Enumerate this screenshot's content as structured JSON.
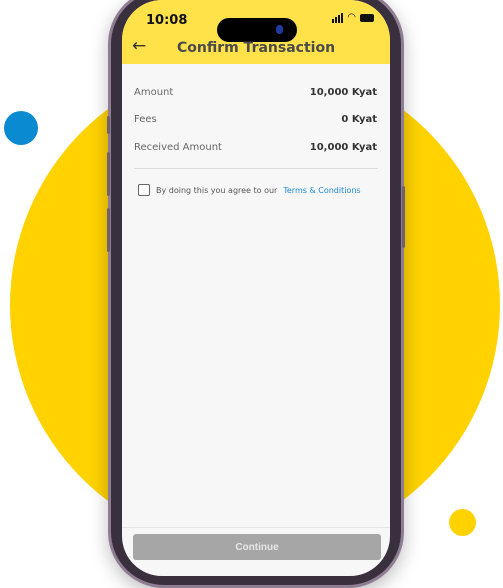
{
  "status_bar": {
    "time": "10:08"
  },
  "header": {
    "title": "Confirm Transaction",
    "back_icon": "arrow-left-icon",
    "background": "#FFE14A"
  },
  "details": [
    {
      "label": "Amount",
      "value": "10,000 Kyat"
    },
    {
      "label": "Fees",
      "value": "0 Kyat"
    },
    {
      "label": "Received Amount",
      "value": "10,000 Kyat"
    }
  ],
  "terms": {
    "text": "By doing this you agree to our",
    "link": "Terms & Conditions",
    "checked": false,
    "link_color": "#1C8AD6"
  },
  "footer": {
    "continue_label": "Continue",
    "button_color": "#A6A6A6"
  },
  "colors": {
    "brand_yellow": "#FFD200",
    "accent_blue": "#0A8AD0"
  }
}
